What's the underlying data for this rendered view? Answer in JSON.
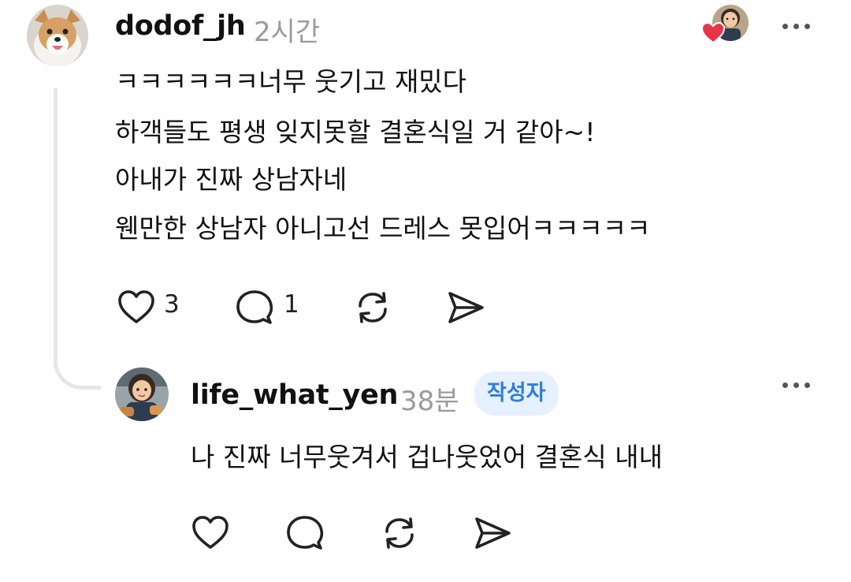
{
  "comment": {
    "username": "dodof_jh",
    "time": "2시간",
    "lines": [
      "ㅋㅋㅋㅋㅋㅋ너무 웃기고 재밌다",
      "하객들도 평생 잊지못할 결혼식일 거 같아~!",
      "아내가 진짜 상남자네",
      "웬만한 상남자 아니고선 드레스 못입어ㅋㅋㅋㅋㅋ"
    ],
    "like_count": "3",
    "reply_count": "1"
  },
  "reply": {
    "username": "life_what_yen",
    "time": "38분",
    "author_badge": "작성자",
    "text": "나 진짜 너무웃겨서 겁나웃었어 결혼식 내내"
  },
  "icons": {
    "like": "heart-outline-icon",
    "reply": "speech-bubble-icon",
    "repost": "repost-arrows-icon",
    "share": "send-icon",
    "more": "more-dots-icon",
    "liked_by_author": "red-heart-icon"
  },
  "colors": {
    "badge_bg": "#e6f1ff",
    "badge_text": "#2e7de1",
    "heart_red": "#e8344a",
    "timestamp": "#9a9a9a",
    "thread_line": "#e6e6e6"
  }
}
